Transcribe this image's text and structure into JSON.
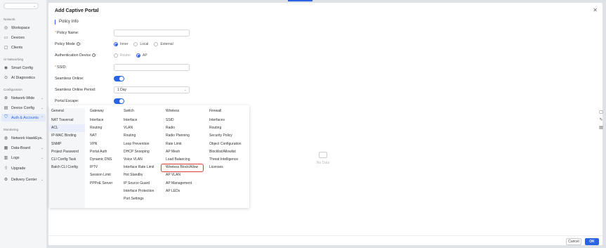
{
  "sidebar": {
    "sections": [
      {
        "label": "Network",
        "items": [
          {
            "label": "Workspace",
            "icon": "workspace-icon"
          },
          {
            "label": "Devices",
            "icon": "devices-icon"
          },
          {
            "label": "Clients",
            "icon": "clients-icon"
          }
        ]
      },
      {
        "label": "AI Networking",
        "items": [
          {
            "label": "Smart Config",
            "icon": "smart-config-icon"
          },
          {
            "label": "AI Diagnostics",
            "icon": "ai-diagnostics-icon"
          }
        ]
      },
      {
        "label": "Configuration",
        "items": [
          {
            "label": "Network-Wide",
            "icon": "network-wide-icon"
          },
          {
            "label": "Device Config",
            "icon": "device-config-icon"
          },
          {
            "label": "Auth & Accounts",
            "icon": "auth-icon"
          }
        ]
      },
      {
        "label": "Monitoring",
        "items": [
          {
            "label": "Network HawkEye",
            "icon": "hawkeye-icon"
          },
          {
            "label": "Data-Board",
            "icon": "data-board-icon"
          },
          {
            "label": "Logs",
            "icon": "logs-icon"
          },
          {
            "label": "Upgrade",
            "icon": "upgrade-icon"
          },
          {
            "label": "Delivery Center",
            "icon": "delivery-center-icon"
          }
        ]
      }
    ]
  },
  "dialog": {
    "title": "Add Captive Portal",
    "section_title": "Policy Info",
    "fields": {
      "policy_name": {
        "label": "Policy Name:",
        "value": ""
      },
      "policy_mode": {
        "label": "Policy Mode",
        "options": [
          "Inner",
          "Local",
          "External"
        ],
        "selected": "Inner"
      },
      "auth_device": {
        "label": "Authentication Device",
        "options": [
          "Router",
          "AP"
        ],
        "selected": "AP"
      },
      "ssid": {
        "label": "SSID:",
        "value": ""
      },
      "seamless_online": {
        "label": "Seamless Online:",
        "on": true
      },
      "seamless_period": {
        "label": "Seamless Online Period:",
        "value": "1 Day"
      },
      "portal_escape": {
        "label": "Portal Escape:",
        "on": true
      }
    },
    "no_data": "No Data",
    "cancel": "Cancel",
    "ok": "OK"
  },
  "mega_menu": {
    "columns": [
      {
        "head": "General",
        "items": [
          "NAT Traversal",
          "ACL",
          "IP-MAC Binding",
          "SNMP",
          "Project Password",
          "CLI Config Task",
          "Batch CLI Config"
        ]
      },
      {
        "head": "Gateway",
        "items": [
          "Interface",
          "Routing",
          "NAT",
          "VPN",
          "Portal Auth",
          "Dynamic DNS",
          "IPTV",
          "Session Limit",
          "PPPoE Server"
        ]
      },
      {
        "head": "Switch",
        "items": [
          "Interface",
          "VLAN",
          "Routing",
          "Loop Prevention",
          "DHCP Snooping",
          "Voice VLAN",
          "Interface Rate Limit",
          "Hot Standby",
          "IP Source Guard",
          "Interface Protection",
          "Port Settings"
        ]
      },
      {
        "head": "Wireless",
        "items": [
          "SSID",
          "Radio",
          "Radio Planning",
          "Rate Limit",
          "AP Mesh",
          "Load Balancing",
          "Wireless Block/Allow",
          "AP VLAN",
          "AP Management",
          "AP LEDs"
        ]
      },
      {
        "head": "Firewall",
        "items": [
          "Interfaces",
          "Routing",
          "Security Policy",
          "Object Configuration",
          "Blocklist/Allowlist",
          "Threat Intelligence",
          "Licenses"
        ]
      }
    ],
    "highlighted_item": "Wireless Block/Allow"
  }
}
